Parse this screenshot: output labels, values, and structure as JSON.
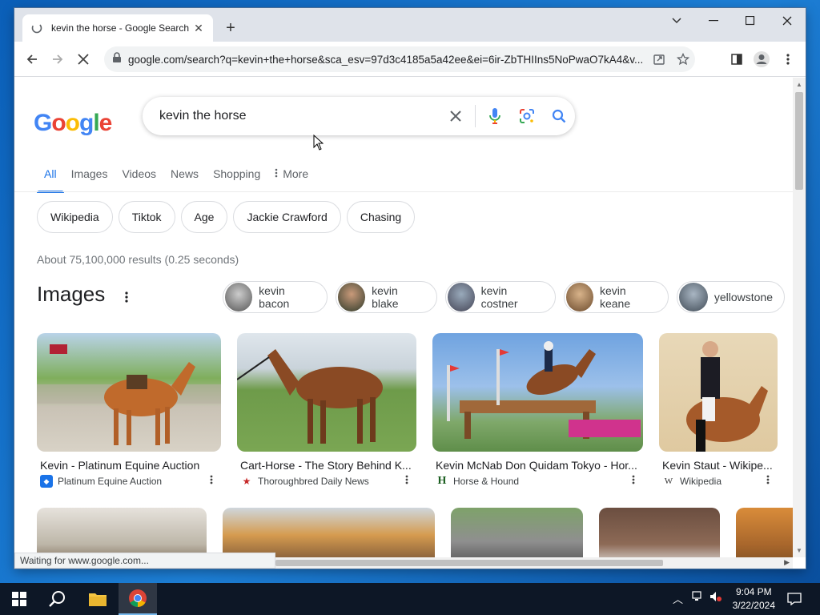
{
  "browser": {
    "tab_title": "kevin the horse - Google Search",
    "url": "google.com/search?q=kevin+the+horse&sca_esv=97d3c4185a5a42ee&ei=6ir-ZbTHIIns5NoPwaO7kA4&v...",
    "status": "Waiting for www.google.com..."
  },
  "search": {
    "logo": [
      "G",
      "o",
      "o",
      "g",
      "l",
      "e"
    ],
    "query": "kevin the horse"
  },
  "tabs": [
    "All",
    "Images",
    "Videos",
    "News",
    "Shopping",
    "More"
  ],
  "chips": [
    "Wikipedia",
    "Tiktok",
    "Age",
    "Jackie Crawford",
    "Chasing"
  ],
  "result_stats": "About 75,100,000 results (0.25 seconds)",
  "images": {
    "heading": "Images",
    "related": [
      "kevin bacon",
      "kevin blake",
      "kevin costner",
      "kevin keane",
      "yellowstone"
    ],
    "cards": [
      {
        "caption": "Kevin - Platinum Equine Auction",
        "source": "Platinum Equine Auction"
      },
      {
        "caption": "Cart-Horse - The Story Behind K...",
        "source": "Thoroughbred Daily News"
      },
      {
        "caption": "Kevin McNab Don Quidam Tokyo - Hor...",
        "source": "Horse & Hound"
      },
      {
        "caption": "Kevin Staut - Wikipe...",
        "source": "Wikipedia"
      }
    ]
  },
  "taskbar": {
    "time": "9:04 PM",
    "date": "3/22/2024"
  },
  "colors": {
    "accent": "#1a73e8",
    "google_blue": "#4285f4",
    "google_red": "#ea4335",
    "google_yellow": "#fbbc05",
    "google_green": "#34a853"
  }
}
